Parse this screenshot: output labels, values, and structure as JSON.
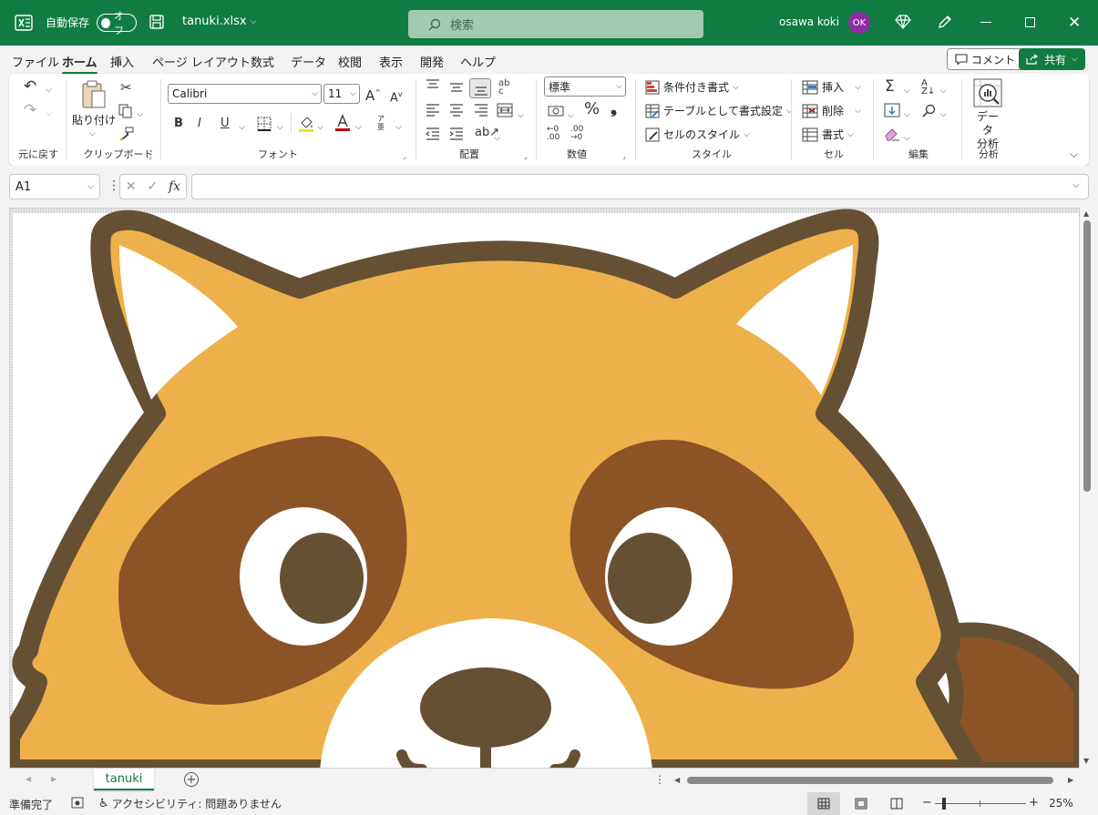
{
  "titlebar": {
    "autosave_label": "自動保存",
    "autosave_state": "オフ",
    "filename": "tanuki.xlsx",
    "search_placeholder": "検索",
    "user_name": "osawa koki",
    "user_initials": "OK"
  },
  "menu_tabs": [
    "ファイル",
    "ホーム",
    "挿入",
    "ページ レイアウト",
    "数式",
    "データ",
    "校閲",
    "表示",
    "開発",
    "ヘルプ"
  ],
  "active_tab": "ホーム",
  "actions": {
    "comment": "コメント",
    "share": "共有"
  },
  "ribbon": {
    "undo_group": "元に戻す",
    "clipboard": {
      "paste": "貼り付け",
      "group": "クリップボード"
    },
    "font": {
      "name": "Calibri",
      "size": "11",
      "group": "フォント",
      "bold": "B",
      "italic": "I",
      "underline": "U"
    },
    "alignment_group": "配置",
    "number": {
      "format": "標準",
      "group": "数値"
    },
    "styles": {
      "conditional": "条件付き書式",
      "table": "テーブルとして書式設定",
      "cell_styles": "セルのスタイル",
      "group": "スタイル"
    },
    "cells": {
      "insert": "挿入",
      "delete": "削除",
      "format": "書式",
      "group": "セル"
    },
    "editing_group": "編集",
    "analysis": {
      "button": "データ\n分析",
      "line1": "データ",
      "line2": "分析",
      "group": "分析"
    }
  },
  "formula_bar": {
    "cell_ref": "A1",
    "fx": "fx",
    "value": ""
  },
  "sheet_tabs": [
    "tanuki"
  ],
  "status": {
    "ready": "準備完了",
    "accessibility": "アクセシビリティ: 問題ありません",
    "zoom": "25%"
  },
  "colors": {
    "brand": "#107c41",
    "fur": "#eeb04a",
    "outline": "#655033",
    "patch": "#8a5426",
    "white": "#ffffff"
  }
}
